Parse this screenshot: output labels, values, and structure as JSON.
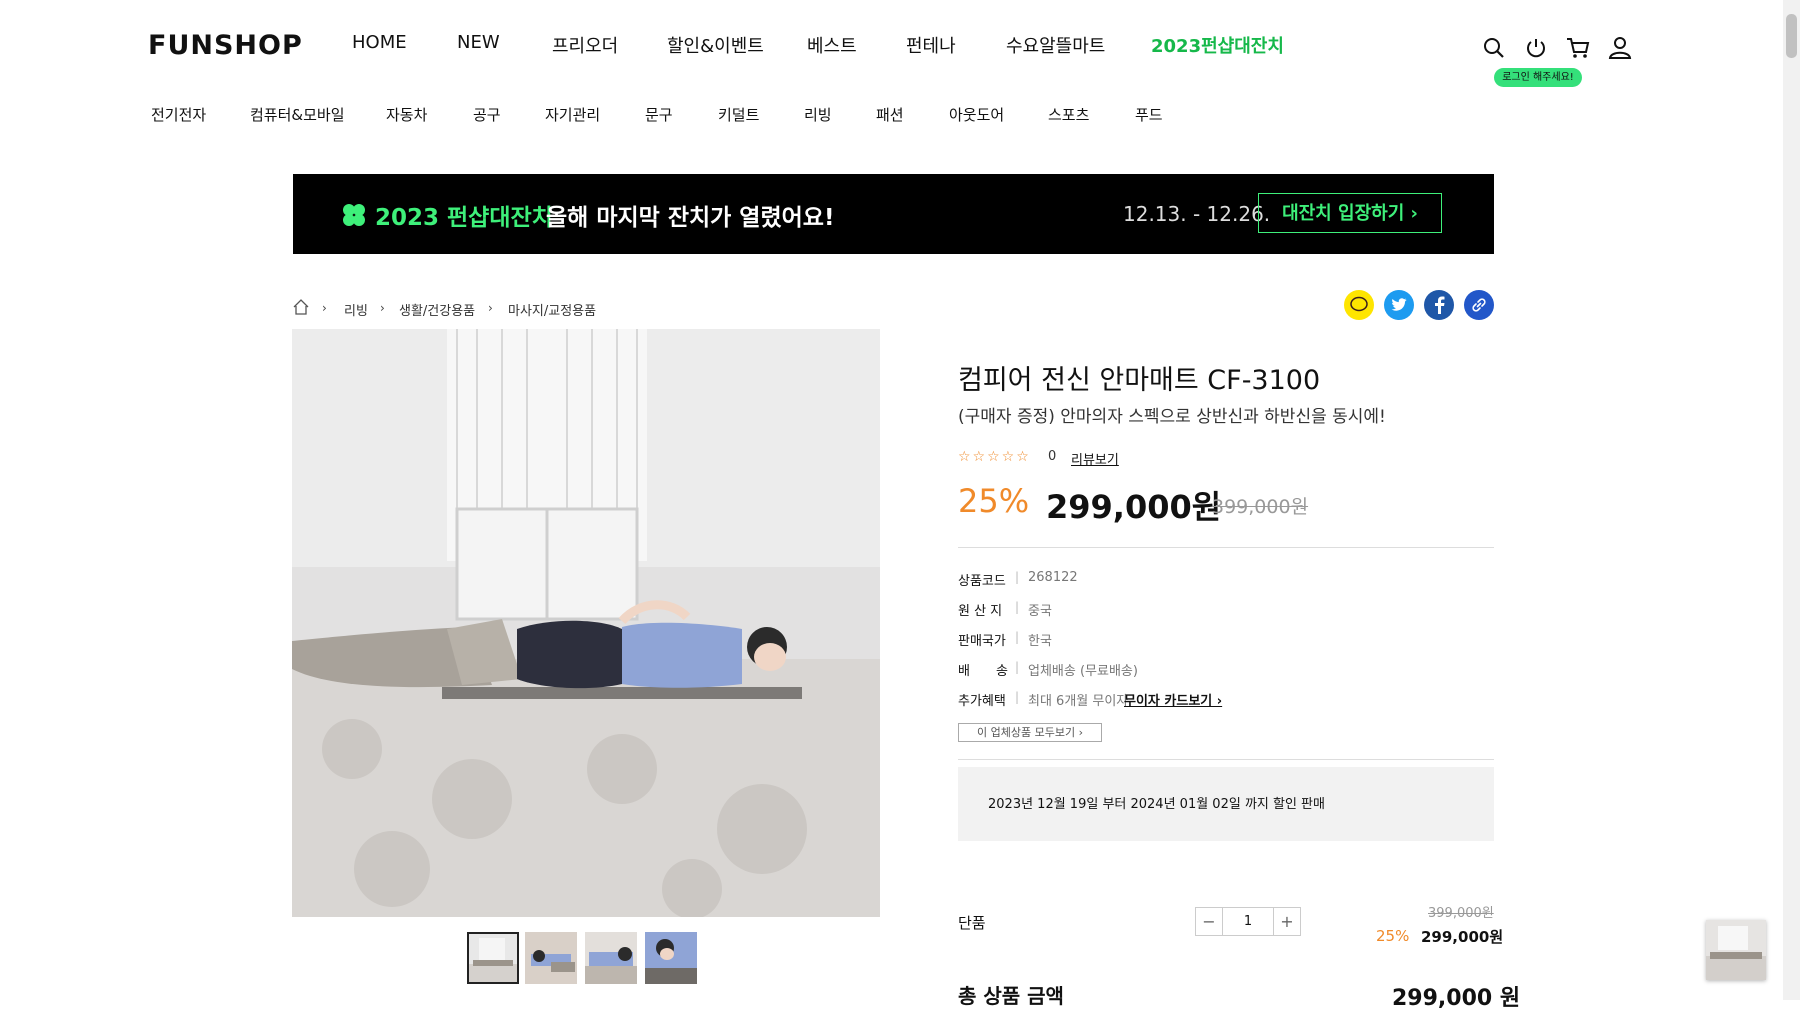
{
  "header": {
    "logo": "FUNSHOP",
    "nav": [
      "HOME",
      "NEW",
      "프리오더",
      "할인&이벤트",
      "베스트",
      "펀테나",
      "수요알뜰마트",
      "2023펀샵대잔치"
    ],
    "login_badge": "로그인 해주세요!"
  },
  "categories": [
    "전기전자",
    "컴퓨터&모바일",
    "자동차",
    "공구",
    "자기관리",
    "문구",
    "키덜트",
    "리빙",
    "패션",
    "아웃도어",
    "스포츠",
    "푸드"
  ],
  "banner": {
    "title_green": "2023 펀샵대잔치",
    "title_white": "올해 마지막 잔치가 열렸어요!",
    "date": "12.13. - 12.26.",
    "cta": "대잔치 입장하기 ›"
  },
  "breadcrumb": [
    "리빙",
    "생활/건강용품",
    "마사지/교정용품"
  ],
  "product": {
    "title": "컴피어 전신 안마매트 CF-3100",
    "subtitle": "(구매자 증정) 안마의자 스펙으로 상반신과 하반신을 동시에!",
    "stars": "☆☆☆☆☆",
    "review_count": "0",
    "review_link": "리뷰보기",
    "discount": "25%",
    "price": "299,000원",
    "original_price": "399,000원",
    "info": [
      {
        "label": "상품코드",
        "value": "268122"
      },
      {
        "label": "원 산 지",
        "value": "중국"
      },
      {
        "label": "판매국가",
        "value": "한국"
      },
      {
        "label": "배　　송",
        "value": "업체배송 (무료배송)"
      },
      {
        "label": "추가혜택",
        "value": "최대 6개월 무이자",
        "link": "무이자 카드보기 ›"
      }
    ],
    "all_products_btn": "이 업체상품 모두보기 ›",
    "notice": "2023년 12월 19일 부터 2024년 01월 02일 까지 할인 판매"
  },
  "option": {
    "label": "단품",
    "quantity": "1",
    "minus": "−",
    "plus": "+",
    "original": "399,000원",
    "discount": "25%",
    "price": "299,000원"
  },
  "total": {
    "label": "총 상품 금액",
    "value": "299,000 원"
  },
  "colors": {
    "accent_green": "#16b84a",
    "banner_green": "#3ef07a",
    "discount_orange": "#f08a2a"
  }
}
